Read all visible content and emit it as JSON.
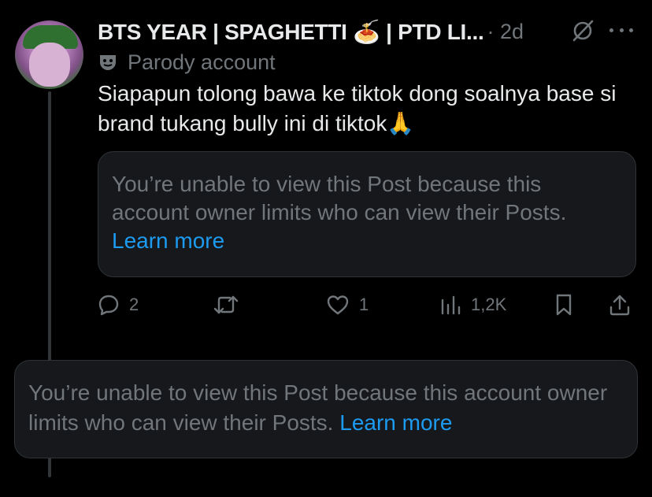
{
  "post": {
    "display_name": "BTS YEAR | SPAGHETTI 🍝 | PTD LI...",
    "timestamp": "· 2d",
    "label": "Parody account",
    "text": "Siapapun tolong bawa ke tiktok dong soalnya base si brand tukang bully ini di tiktok🙏",
    "quote_notice": {
      "text": "You’re unable to view this Post because this account owner limits who can view their Posts. ",
      "link": "Learn more"
    },
    "actions": {
      "replies": "2",
      "reposts": "",
      "likes": "1",
      "views": "1,2K"
    }
  },
  "unavailable_post": {
    "text": "You’re unable to view this Post because this account owner limits who can view their Posts. ",
    "link": "Learn more"
  },
  "icons": {
    "grok": "grok-icon",
    "more": "more-icon",
    "parody": "mask-icon",
    "reply": "reply-icon",
    "repost": "repost-icon",
    "like": "heart-icon",
    "views": "views-icon",
    "bookmark": "bookmark-icon",
    "share": "share-icon"
  },
  "colors": {
    "background": "#000000",
    "text": "#e7e9ea",
    "muted": "#71767b",
    "link": "#1d9bf0",
    "card": "#16181c"
  }
}
